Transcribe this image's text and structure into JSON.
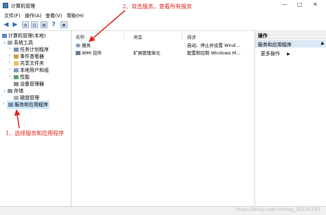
{
  "window": {
    "title": "计算机管理",
    "minimize": "—",
    "maximize": "□",
    "close": "✕"
  },
  "menu": [
    "文件(F)",
    "操作(A)",
    "查看(V)",
    "帮助(H)"
  ],
  "tree": {
    "root": "计算机管理(本地)",
    "system_tools": "系统工具",
    "task_scheduler": "任务计划程序",
    "event_viewer": "事件查看器",
    "shared_folders": "共享文件夹",
    "local_users": "本地用户和组",
    "performance": "性能",
    "device_manager": "设备管理器",
    "storage": "存储",
    "disk_management": "磁盘管理",
    "services_apps": "服务和应用程序"
  },
  "list": {
    "columns": [
      "名称",
      "类型",
      "描述"
    ],
    "rows": [
      {
        "name": "服务",
        "type": "",
        "description": "启动、停止并设置 Wind..."
      },
      {
        "name": "WMI 控件",
        "type": "扩展管理单元",
        "description": "配置和控制 Windows M..."
      }
    ]
  },
  "actions": {
    "header": "操作",
    "section": "服务和应用程序",
    "more": "更多操作"
  },
  "annotations": {
    "step1": "1、选择服务和应用程序",
    "step2": "2、双击服务，查看所有服务"
  },
  "watermark": "https://blog.csdn.net/qq_39135287",
  "colors": {
    "annotation": "#e2231a",
    "selection": "#cce8ff",
    "action_section": "#dbe7f5"
  }
}
